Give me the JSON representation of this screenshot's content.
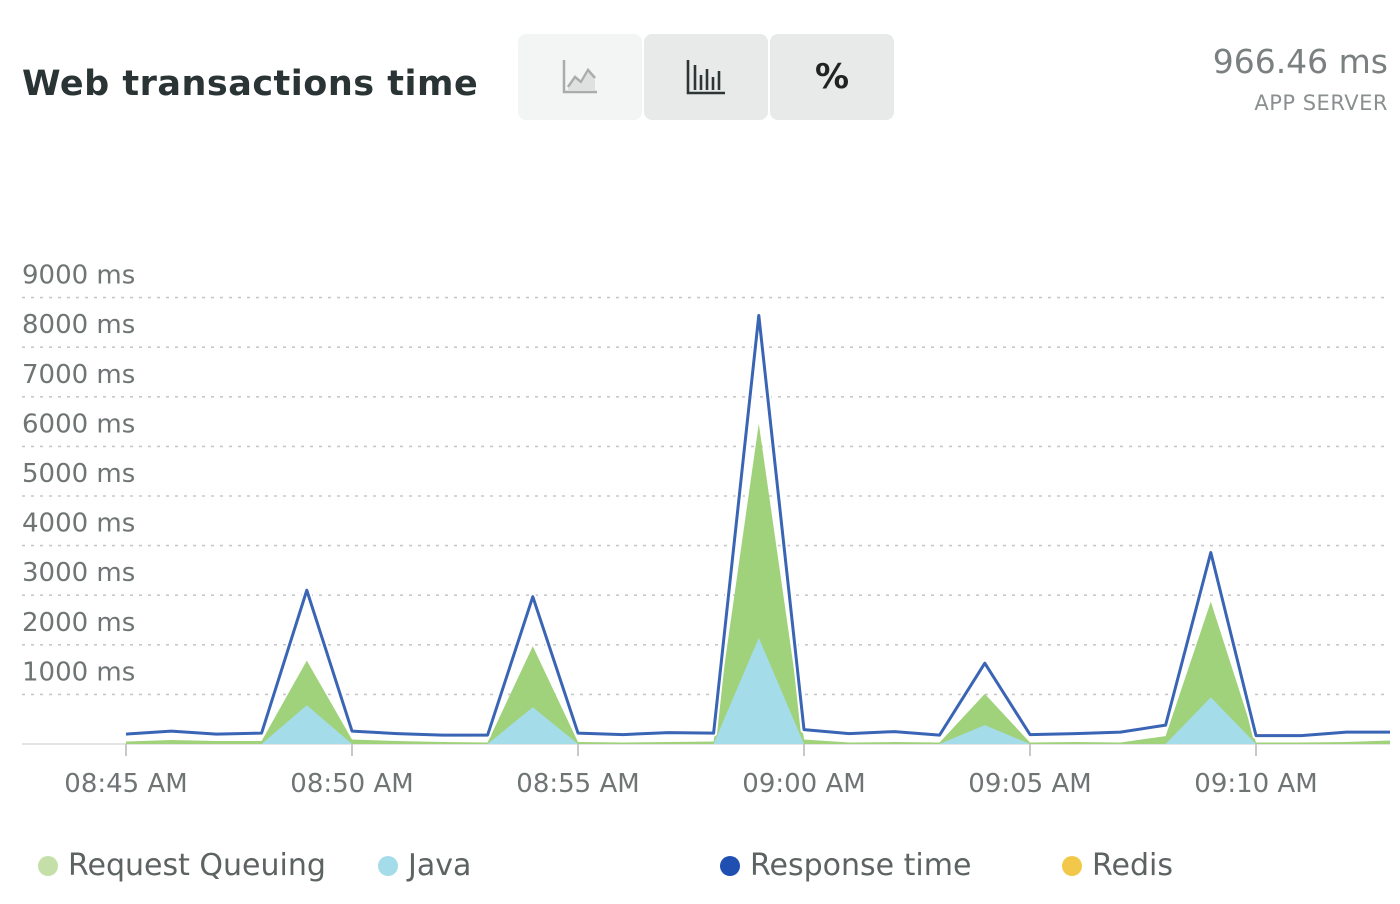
{
  "header": {
    "title": "Web transactions time",
    "summary_value": "966.46 ms",
    "summary_label": "APP SERVER",
    "toggle": [
      {
        "icon": "area-chart-icon",
        "selected": false
      },
      {
        "icon": "bar-chart-icon",
        "selected": true
      },
      {
        "icon": "percent-icon",
        "label": "%",
        "selected": false
      }
    ]
  },
  "colors": {
    "request_queuing": "#a0d27b",
    "java": "#a5dcea",
    "response_time": "#3a64b4",
    "redis": "#f1c84a",
    "grid": "#c8c8c8",
    "axis_text": "#6f7474"
  },
  "chart_data": {
    "type": "area",
    "title": "Web transactions time",
    "ylim": [
      0,
      9000
    ],
    "y_ticks": [
      1000,
      2000,
      3000,
      4000,
      5000,
      6000,
      7000,
      8000,
      9000
    ],
    "y_tick_labels": [
      "1000 ms",
      "2000 ms",
      "3000 ms",
      "4000 ms",
      "5000 ms",
      "6000 ms",
      "7000 ms",
      "8000 ms",
      "9000 ms"
    ],
    "x_minutes": [
      "08:45",
      "08:46",
      "08:47",
      "08:48",
      "08:49",
      "08:50",
      "08:51",
      "08:52",
      "08:53",
      "08:54",
      "08:55",
      "08:56",
      "08:57",
      "08:58",
      "08:59",
      "09:00",
      "09:01",
      "09:02",
      "09:03",
      "09:04",
      "09:05",
      "09:06",
      "09:07",
      "09:08",
      "09:09",
      "09:10",
      "09:11",
      "09:12",
      "09:13"
    ],
    "x_ticks": [
      "08:45 AM",
      "08:50 AM",
      "08:55 AM",
      "09:00 AM",
      "09:05 AM",
      "09:10 AM"
    ],
    "grid": "dotted horizontal",
    "legend_position": "bottom",
    "series": [
      {
        "name": "Request Queuing",
        "values": [
          50,
          80,
          60,
          60,
          1680,
          90,
          60,
          40,
          30,
          1970,
          40,
          30,
          40,
          50,
          6460,
          90,
          30,
          40,
          30,
          1010,
          30,
          40,
          30,
          160,
          2870,
          30,
          30,
          40,
          70
        ]
      },
      {
        "name": "Java",
        "values": [
          0,
          0,
          0,
          0,
          780,
          0,
          0,
          0,
          0,
          740,
          0,
          0,
          0,
          0,
          2140,
          0,
          0,
          0,
          0,
          380,
          0,
          0,
          0,
          0,
          940,
          0,
          0,
          0,
          0
        ]
      },
      {
        "name": "Response time",
        "values": [
          200,
          260,
          200,
          220,
          3100,
          260,
          210,
          180,
          180,
          2970,
          220,
          190,
          230,
          220,
          8640,
          290,
          210,
          250,
          180,
          1630,
          190,
          210,
          240,
          380,
          3860,
          170,
          170,
          240,
          240
        ]
      },
      {
        "name": "Redis",
        "values": [
          0,
          0,
          0,
          0,
          0,
          0,
          0,
          0,
          0,
          0,
          0,
          0,
          0,
          0,
          0,
          0,
          0,
          0,
          0,
          0,
          0,
          0,
          0,
          0,
          0,
          0,
          0,
          0,
          0
        ]
      }
    ]
  },
  "legend": [
    {
      "label": "Request Queuing",
      "color": "#c4e0a8"
    },
    {
      "label": "Java",
      "color": "#a5dcea"
    },
    {
      "label": "Response time",
      "color": "#1f4fb0"
    },
    {
      "label": "Redis",
      "color": "#f1c84a"
    }
  ]
}
